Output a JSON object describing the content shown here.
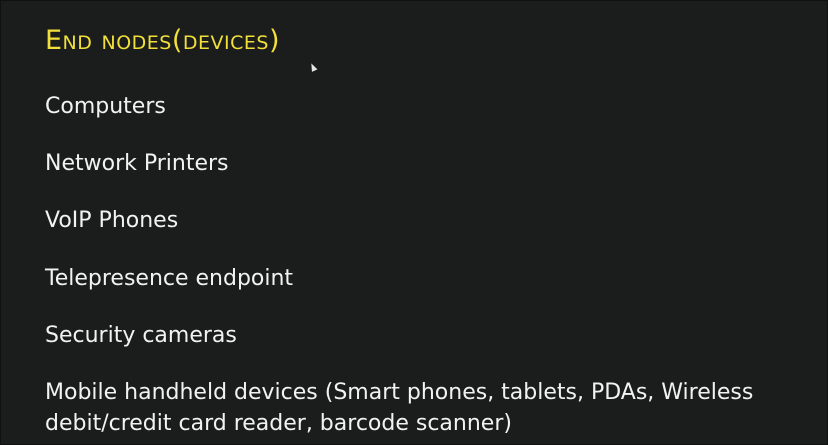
{
  "slide": {
    "title": "End nodes(devices)",
    "items": [
      "Computers",
      "Network Printers",
      "VoIP Phones",
      "Telepresence endpoint",
      "Security cameras",
      "Mobile handheld  devices (Smart phones, tablets, PDAs, Wireless debit/credit card reader, barcode scanner)"
    ]
  },
  "colors": {
    "background": "#1b1d1c",
    "title": "#f1df3a",
    "text": "#f2f2f2"
  }
}
